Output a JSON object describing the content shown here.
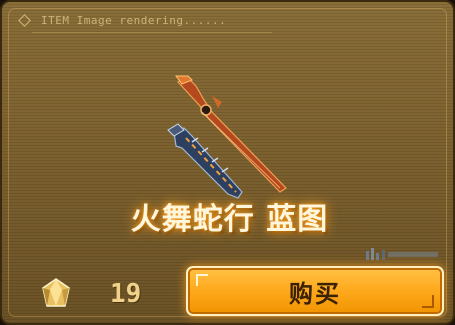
{
  "header": {
    "status_text": "ITEM Image rendering......"
  },
  "item": {
    "name": "火舞蛇行 蓝图"
  },
  "price": {
    "currency_icon": "crystal-icon",
    "value": "19"
  },
  "actions": {
    "buy_label": "购买"
  },
  "colors": {
    "accent": "#ffab1f",
    "panel": "#7a5f2e",
    "title_glow": "#ffaa28"
  }
}
